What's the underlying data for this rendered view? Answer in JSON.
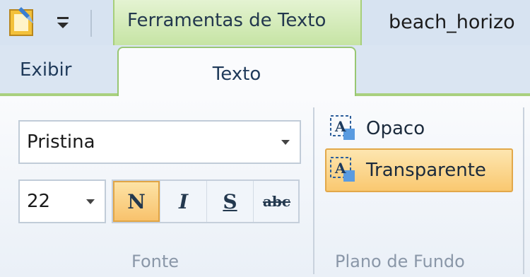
{
  "titlebar": {
    "context_tab_label": "Ferramentas de Texto",
    "window_title": "beach_horizo"
  },
  "tabs": {
    "exibir": "Exibir",
    "texto": "Texto"
  },
  "font_group": {
    "font_name": "Pristina",
    "font_size": "22",
    "bold_label": "N",
    "italic_label": "I",
    "underline_label": "S",
    "strike_label": "abc",
    "group_label": "Fonte"
  },
  "background_group": {
    "opaque_label": "Opaco",
    "transparent_label": "Transparente",
    "group_label": "Plano de Fundo"
  },
  "colors": {
    "context_tab_green": "#c6e4a4",
    "active_button_orange": "#f8c26c"
  }
}
